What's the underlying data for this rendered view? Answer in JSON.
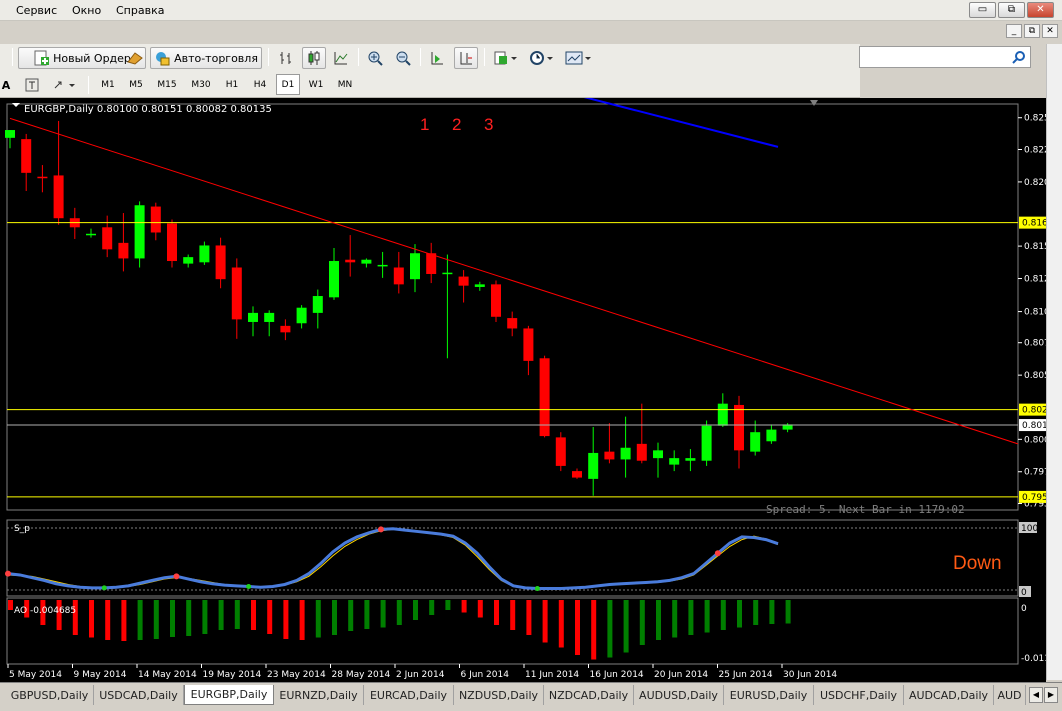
{
  "menu": [
    "Сервис",
    "Окно",
    "Справка"
  ],
  "window_controls": [
    "▭",
    "⧉",
    "✕"
  ],
  "mdi_controls": [
    "_",
    "⧉",
    "✕"
  ],
  "toolbar": {
    "new_order_label": "Новый Ордер",
    "autotrade_label": "Авто-торговля"
  },
  "timeframes": [
    "M1",
    "M5",
    "M15",
    "M30",
    "H1",
    "H4",
    "D1",
    "W1",
    "MN"
  ],
  "active_timeframe": "D1",
  "search": {
    "placeholder": ""
  },
  "chart": {
    "header": "EURGBP,Daily  0.80100 0.80151 0.80082 0.80135",
    "annotations": [
      "1",
      "2",
      "3"
    ],
    "spread_text": "Spread: 5.  Next Bar in 1179:02",
    "signal_text": "Down",
    "price_scale": [
      "0.82505",
      "0.82260",
      "0.82010",
      "0.81515",
      "0.81265",
      "0.81010",
      "0.80770",
      "0.80520",
      "0.80025",
      "0.79775",
      "0.79530"
    ],
    "price_tags": [
      {
        "label": "0.81696",
        "price": 0.81696,
        "color": "#ffff00"
      },
      {
        "label": "0.80254",
        "price": 0.80254,
        "color": "#ffff00"
      },
      {
        "label": "0.80135",
        "price": 0.80135,
        "color": "#ffffff"
      },
      {
        "label": "0.79581",
        "price": 0.79581,
        "color": "#ffff00"
      }
    ],
    "stoch": {
      "name": "S_p",
      "scale": [
        "100",
        "0"
      ]
    },
    "ao": {
      "name": "AO -0.004685",
      "scale": [
        "0",
        "-0.011971"
      ]
    },
    "dates": [
      "5 May 2014",
      "9 May 2014",
      "14 May 2014",
      "19 May 2014",
      "23 May 2014",
      "28 May 2014",
      "2 Jun 2014",
      "6 Jun 2014",
      "11 Jun 2014",
      "16 Jun 2014",
      "20 Jun 2014",
      "25 Jun 2014",
      "30 Jun 2014"
    ]
  },
  "colors": {
    "bull": "#00ff00",
    "bear": "#ff0000",
    "trend": "#ff0000",
    "level": "#ffff00",
    "blue_line": "#0000ff",
    "stoch_main": "#4a7cdc",
    "stoch_signal": "#ffd700"
  },
  "chart_data": {
    "type": "candlestick",
    "symbol": "EURGBP",
    "timeframe": "Daily",
    "ylim": [
      0.7948,
      0.8258
    ],
    "candles": [
      {
        "o": 0.8235,
        "h": 0.8241,
        "l": 0.8227,
        "c": 0.8241
      },
      {
        "o": 0.8234,
        "h": 0.8238,
        "l": 0.8194,
        "c": 0.8208
      },
      {
        "o": 0.8205,
        "h": 0.8214,
        "l": 0.8193,
        "c": 0.8204
      },
      {
        "o": 0.8206,
        "h": 0.8248,
        "l": 0.8168,
        "c": 0.8173
      },
      {
        "o": 0.8173,
        "h": 0.8181,
        "l": 0.8157,
        "c": 0.8166
      },
      {
        "o": 0.816,
        "h": 0.8165,
        "l": 0.8158,
        "c": 0.8161
      },
      {
        "o": 0.8166,
        "h": 0.8175,
        "l": 0.8143,
        "c": 0.8149
      },
      {
        "o": 0.8154,
        "h": 0.8177,
        "l": 0.8132,
        "c": 0.8142
      },
      {
        "o": 0.8142,
        "h": 0.8186,
        "l": 0.8135,
        "c": 0.8183
      },
      {
        "o": 0.8182,
        "h": 0.8185,
        "l": 0.8156,
        "c": 0.8162
      },
      {
        "o": 0.8169,
        "h": 0.8172,
        "l": 0.8135,
        "c": 0.814
      },
      {
        "o": 0.8138,
        "h": 0.8145,
        "l": 0.8135,
        "c": 0.8143
      },
      {
        "o": 0.8139,
        "h": 0.8155,
        "l": 0.8137,
        "c": 0.8152
      },
      {
        "o": 0.8152,
        "h": 0.8158,
        "l": 0.8119,
        "c": 0.8126
      },
      {
        "o": 0.8135,
        "h": 0.8142,
        "l": 0.808,
        "c": 0.8095
      },
      {
        "o": 0.8093,
        "h": 0.8105,
        "l": 0.8082,
        "c": 0.81
      },
      {
        "o": 0.8093,
        "h": 0.8102,
        "l": 0.8082,
        "c": 0.81
      },
      {
        "o": 0.809,
        "h": 0.8095,
        "l": 0.8079,
        "c": 0.8085
      },
      {
        "o": 0.8092,
        "h": 0.8106,
        "l": 0.8088,
        "c": 0.8104
      },
      {
        "o": 0.81,
        "h": 0.8118,
        "l": 0.8088,
        "c": 0.8113
      },
      {
        "o": 0.8112,
        "h": 0.815,
        "l": 0.811,
        "c": 0.814
      },
      {
        "o": 0.8141,
        "h": 0.816,
        "l": 0.8128,
        "c": 0.8139
      },
      {
        "o": 0.8138,
        "h": 0.8142,
        "l": 0.8135,
        "c": 0.8141
      },
      {
        "o": 0.8137,
        "h": 0.8147,
        "l": 0.8127,
        "c": 0.8137
      },
      {
        "o": 0.8135,
        "h": 0.8147,
        "l": 0.8115,
        "c": 0.8122
      },
      {
        "o": 0.8126,
        "h": 0.8153,
        "l": 0.8116,
        "c": 0.8146
      },
      {
        "o": 0.8146,
        "h": 0.8154,
        "l": 0.8123,
        "c": 0.813
      },
      {
        "o": 0.813,
        "h": 0.8145,
        "l": 0.8065,
        "c": 0.8131
      },
      {
        "o": 0.8128,
        "h": 0.8133,
        "l": 0.8108,
        "c": 0.8121
      },
      {
        "o": 0.812,
        "h": 0.8124,
        "l": 0.8117,
        "c": 0.8122
      },
      {
        "o": 0.8122,
        "h": 0.8125,
        "l": 0.8093,
        "c": 0.8097
      },
      {
        "o": 0.8096,
        "h": 0.8101,
        "l": 0.8082,
        "c": 0.8088
      },
      {
        "o": 0.8088,
        "h": 0.809,
        "l": 0.8052,
        "c": 0.8063
      },
      {
        "o": 0.8065,
        "h": 0.8067,
        "l": 0.8004,
        "c": 0.8005
      },
      {
        "o": 0.8004,
        "h": 0.8008,
        "l": 0.7978,
        "c": 0.7982
      },
      {
        "o": 0.7978,
        "h": 0.798,
        "l": 0.7972,
        "c": 0.7973
      },
      {
        "o": 0.7972,
        "h": 0.8012,
        "l": 0.7959,
        "c": 0.7992
      },
      {
        "o": 0.7993,
        "h": 0.8015,
        "l": 0.7984,
        "c": 0.7987
      },
      {
        "o": 0.7987,
        "h": 0.802,
        "l": 0.7973,
        "c": 0.7996
      },
      {
        "o": 0.7999,
        "h": 0.803,
        "l": 0.7984,
        "c": 0.7986
      },
      {
        "o": 0.7988,
        "h": 0.8,
        "l": 0.7973,
        "c": 0.7994
      },
      {
        "o": 0.7983,
        "h": 0.7994,
        "l": 0.7978,
        "c": 0.7988
      },
      {
        "o": 0.7986,
        "h": 0.7995,
        "l": 0.7978,
        "c": 0.7988
      },
      {
        "o": 0.7986,
        "h": 0.8017,
        "l": 0.7982,
        "c": 0.8013
      },
      {
        "o": 0.8013,
        "h": 0.8038,
        "l": 0.8012,
        "c": 0.803
      },
      {
        "o": 0.8029,
        "h": 0.8036,
        "l": 0.798,
        "c": 0.7994
      },
      {
        "o": 0.7993,
        "h": 0.8017,
        "l": 0.799,
        "c": 0.8008
      },
      {
        "o": 0.8001,
        "h": 0.8014,
        "l": 0.7999,
        "c": 0.801
      },
      {
        "o": 0.801,
        "h": 0.8015,
        "l": 0.8008,
        "c": 0.8014
      }
    ],
    "stochastic_main": [
      30,
      28,
      24,
      20,
      15,
      12,
      10,
      9,
      9,
      10,
      12,
      16,
      20,
      24,
      26,
      22,
      18,
      15,
      13,
      12,
      11,
      10,
      11,
      14,
      20,
      30,
      45,
      62,
      75,
      84,
      90,
      95,
      96,
      94,
      92,
      90,
      88,
      85,
      75,
      60,
      40,
      22,
      12,
      9,
      8,
      8,
      8,
      9,
      10,
      12,
      14,
      15,
      16,
      17,
      18,
      20,
      24,
      30,
      45,
      60,
      75,
      84,
      83,
      80,
      74
    ],
    "stochastic_signal": [
      28,
      27,
      26,
      22,
      18,
      14,
      11,
      9,
      8,
      9,
      11,
      14,
      18,
      22,
      24,
      23,
      20,
      17,
      14,
      12,
      11,
      10,
      10,
      13,
      18,
      26,
      40,
      56,
      70,
      80,
      88,
      93,
      95,
      94,
      92,
      90,
      87,
      83,
      72,
      55,
      36,
      20,
      11,
      8,
      8,
      8,
      8,
      9,
      10,
      12,
      13,
      14,
      15,
      16,
      17,
      19,
      22,
      28,
      42,
      56,
      70,
      80,
      85,
      81,
      73
    ],
    "ao_values": [
      -0.002,
      -0.0035,
      -0.005,
      -0.006,
      -0.007,
      -0.0075,
      -0.008,
      -0.0082,
      -0.008,
      -0.0078,
      -0.0074,
      -0.0072,
      -0.0068,
      -0.006,
      -0.0058,
      -0.006,
      -0.0068,
      -0.0078,
      -0.008,
      -0.0075,
      -0.007,
      -0.0062,
      -0.0058,
      -0.0055,
      -0.005,
      -0.004,
      -0.003,
      -0.002,
      -0.0025,
      -0.0035,
      -0.005,
      -0.006,
      -0.007,
      -0.0085,
      -0.0095,
      -0.011,
      -0.0119,
      -0.0115,
      -0.0105,
      -0.009,
      -0.008,
      -0.0075,
      -0.007,
      -0.0065,
      -0.006,
      -0.0055,
      -0.005,
      -0.0048,
      -0.0047
    ]
  },
  "symbol_tabs": [
    "GBPUSD,Daily",
    "USDCAD,Daily",
    "EURGBP,Daily",
    "EURNZD,Daily",
    "EURCAD,Daily",
    "NZDUSD,Daily",
    "NZDCAD,Daily",
    "AUDUSD,Daily",
    "EURUSD,Daily",
    "USDCHF,Daily",
    "AUDCAD,Daily",
    "AUD"
  ],
  "active_tab": "EURGBP,Daily"
}
